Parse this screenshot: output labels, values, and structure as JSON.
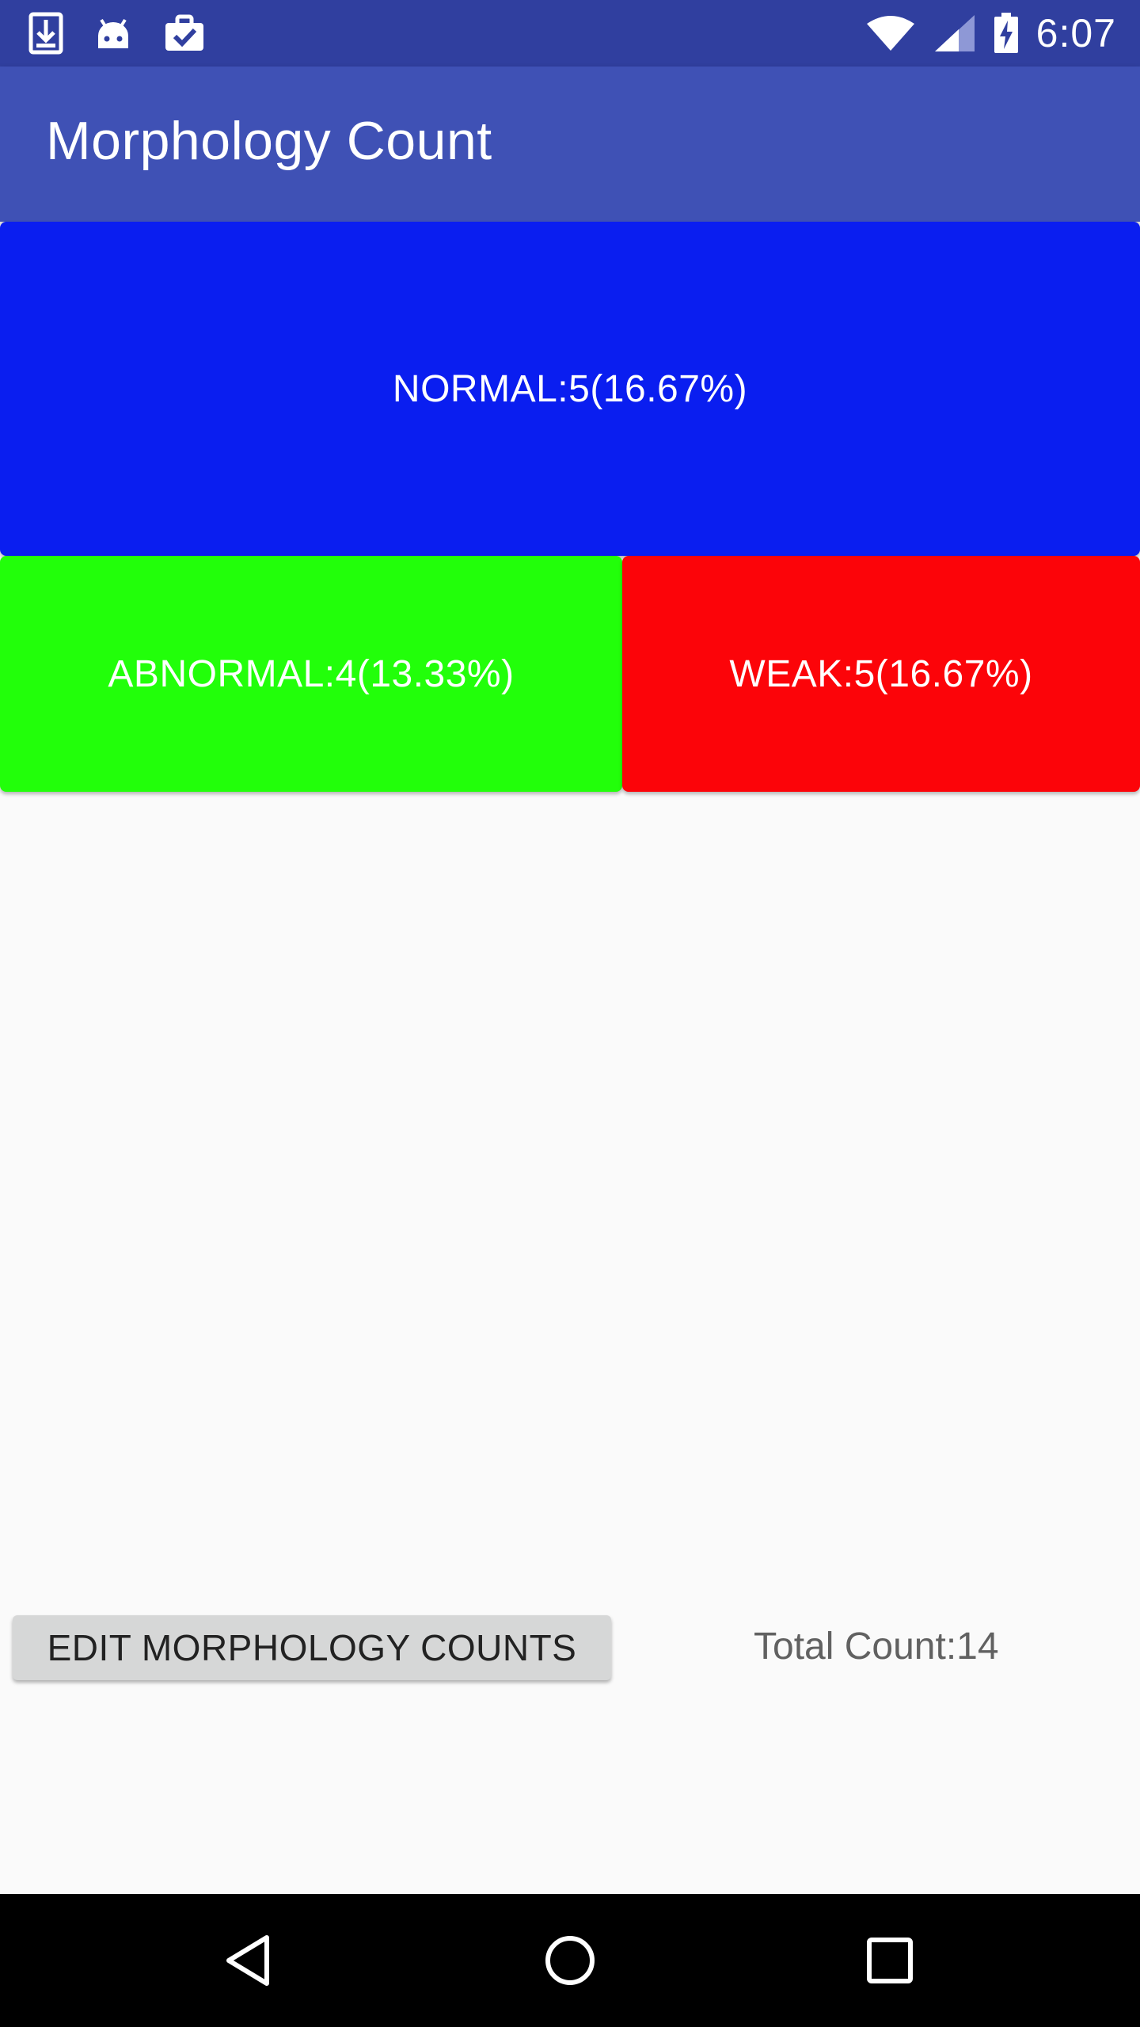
{
  "status_bar": {
    "time": "6:07",
    "icons": [
      "download-icon",
      "android-icon",
      "clipboard-check-icon",
      "wifi-icon",
      "cell-signal-icon",
      "battery-charging-icon"
    ]
  },
  "app_bar": {
    "title": "Morphology Count"
  },
  "tiles": {
    "normal": {
      "label": "NORMAL:5(16.67%)",
      "color": "#0a1ef0"
    },
    "abnormal": {
      "label": "ABNORMAL:4(13.33%)",
      "color": "#22ff0a"
    },
    "weak": {
      "label": "WEAK:5(16.67%)",
      "color": "#fc0409"
    }
  },
  "footer": {
    "edit_button_label": "EDIT MORPHOLOGY COUNTS",
    "total_count": "Total Count:14"
  },
  "nav_bar": {
    "icons": [
      "back-icon",
      "home-icon",
      "recents-icon"
    ]
  },
  "colors": {
    "status_bar": "#303f9f",
    "app_bar": "#3f51b5",
    "background": "#fafafa"
  }
}
